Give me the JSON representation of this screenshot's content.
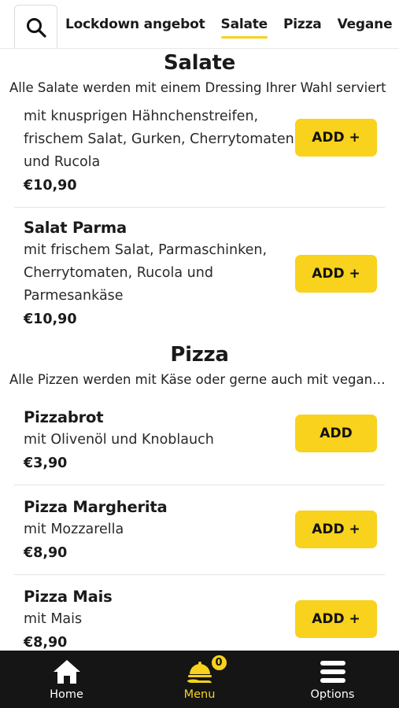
{
  "header": {
    "search_icon": "search-icon",
    "categories": [
      {
        "label": "Lockdown angebot",
        "active": false
      },
      {
        "label": "Salate",
        "active": true
      },
      {
        "label": "Pizza",
        "active": false
      },
      {
        "label": "Vegane",
        "active": false
      }
    ]
  },
  "sections": {
    "salate": {
      "title": "Salate",
      "description": "Alle Salate werden mit einem Dressing Ihrer Wahl serviert",
      "items": [
        {
          "name": "",
          "description": "mit knusprigen Hähnchenstreifen, frischem Salat, Gurken, Cherrytomaten und Rucola",
          "price": "€10,90",
          "button": "ADD +"
        },
        {
          "name": "Salat Parma",
          "description": "mit frischem Salat, Parmaschinken, Cherrytomaten, Rucola und Parmesankäse",
          "price": "€10,90",
          "button": "ADD +"
        }
      ]
    },
    "pizza": {
      "title": "Pizza",
      "description": "Alle Pizzen werden mit Käse oder gerne auch mit veganem Käse zubereitet",
      "items": [
        {
          "name": "Pizzabrot",
          "description": "mit Olivenöl und Knoblauch",
          "price": "€3,90",
          "button": "ADD"
        },
        {
          "name": "Pizza Margherita",
          "description": "mit Mozzarella",
          "price": "€8,90",
          "button": "ADD +"
        },
        {
          "name": "Pizza Mais",
          "description": "mit Mais",
          "price": "€8,90",
          "button": "ADD +"
        }
      ]
    }
  },
  "bottom_nav": {
    "items": [
      {
        "label": "Home",
        "icon": "home-icon",
        "active": false
      },
      {
        "label": "Menu",
        "icon": "food-tray-icon",
        "active": true,
        "badge": "0"
      },
      {
        "label": "Options",
        "icon": "menu-bars-icon",
        "active": false
      }
    ]
  },
  "colors": {
    "accent": "#f8d21c",
    "nav_bg": "#151515"
  }
}
